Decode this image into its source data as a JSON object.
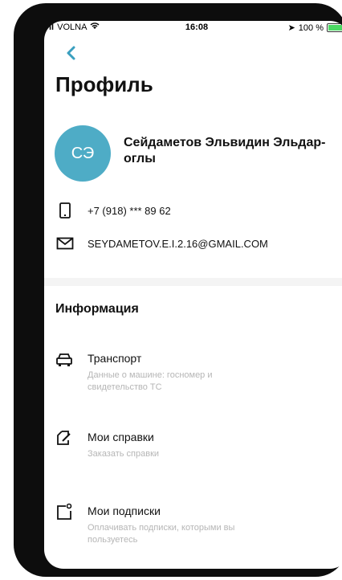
{
  "status_bar": {
    "carrier": "VOLNA",
    "time": "16:08",
    "battery": "100 %"
  },
  "header": {
    "title": "Профиль"
  },
  "profile": {
    "initials": "СЭ",
    "name": "Сейдаметов Эльвидин Эльдар-оглы",
    "phone": "+7 (918) *** 89 62",
    "email": "SEYDAMETOV.E.I.2.16@GMAIL.COM",
    "avatar_color": "#4eacc6"
  },
  "info": {
    "heading": "Информация",
    "items": [
      {
        "title": "Транспорт",
        "subtitle": "Данные о машине: госномер и свидетельство ТС",
        "icon": "car-icon"
      },
      {
        "title": "Мои справки",
        "subtitle": "Заказать справки",
        "icon": "document-edit-icon"
      },
      {
        "title": "Мои подписки",
        "subtitle": "Оплачивать подписки, которыми вы пользуетесь",
        "icon": "subscription-icon"
      }
    ]
  },
  "colors": {
    "accent": "#3a9fbf",
    "subtext": "#b6b6b6"
  }
}
